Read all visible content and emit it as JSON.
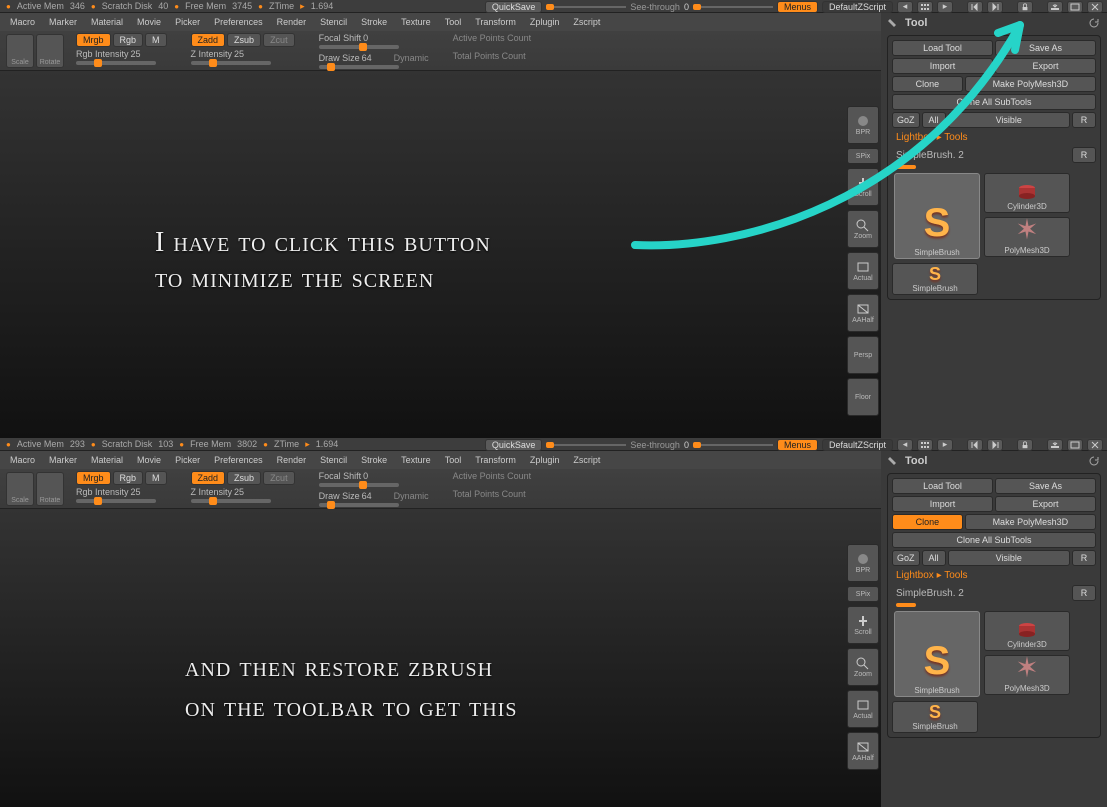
{
  "top": {
    "stats": {
      "active_mem_label": "Active Mem",
      "active_mem_value": "346",
      "scratch_label": "Scratch Disk",
      "scratch_value": "40",
      "free_mem_label": "Free Mem",
      "free_mem_value": "3745",
      "ztime_label": "ZTime",
      "ztime_value": "1.694"
    },
    "quicksave": "QuickSave",
    "see_through_label": "See-through",
    "see_through_value": "0",
    "menus": "Menus",
    "default_zscript": "DefaultZScript",
    "menubar": [
      "Macro",
      "Marker",
      "Material",
      "Movie",
      "Picker",
      "Preferences",
      "Render",
      "Stencil",
      "Stroke",
      "Texture",
      "Tool",
      "Transform",
      "Zplugin",
      "Zscript"
    ],
    "shelf": {
      "scale": "Scale",
      "rotate": "Rotate",
      "mrgb": "Mrgb",
      "rgb": "Rgb",
      "m": "M",
      "zadd": "Zadd",
      "zsub": "Zsub",
      "zcut": "Zcut",
      "rgb_intensity_label": "Rgb Intensity",
      "rgb_intensity_value": "25",
      "z_intensity_label": "Z Intensity",
      "z_intensity_value": "25",
      "focal_shift_label": "Focal Shift",
      "focal_shift_value": "0",
      "draw_size_label": "Draw Size",
      "draw_size_value": "64",
      "dynamic": "Dynamic",
      "active_points": "Active Points Count",
      "total_points": "Total Points Count"
    },
    "stack": {
      "bpr": "BPR",
      "spix": "SPix",
      "scroll": "Scroll",
      "zoom": "Zoom",
      "actual": "Actual",
      "aahalf": "AAHalf",
      "persp": "Persp",
      "floor": "Floor"
    },
    "tool": {
      "title": "Tool",
      "load_tool": "Load Tool",
      "save_as": "Save As",
      "import": "Import",
      "export": "Export",
      "clone": "Clone",
      "make_polymesh": "Make PolyMesh3D",
      "clone_all": "Clone All SubTools",
      "goz": "GoZ",
      "all": "All",
      "visible": "Visible",
      "r": "R",
      "lightbox": "Lightbox ▸ Tools",
      "tool_name": "SimpleBrush. 2",
      "r2": "R",
      "thumb_simplebrush": "SimpleBrush",
      "thumb_cylinder": "Cylinder3D",
      "thumb_polymesh": "PolyMesh3D",
      "thumb_simplebrush2": "SimpleBrush"
    },
    "annotation_line1": "I have to click this button",
    "annotation_line2": "to minimize the screen"
  },
  "bottom": {
    "stats": {
      "active_mem_label": "Active Mem",
      "active_mem_value": "293",
      "scratch_label": "Scratch Disk",
      "scratch_value": "103",
      "free_mem_label": "Free Mem",
      "free_mem_value": "3802",
      "ztime_label": "ZTime",
      "ztime_value": "1.694"
    },
    "annotation_line1": "and then restore zbrush",
    "annotation_line2": "on the toolbar to get this"
  }
}
